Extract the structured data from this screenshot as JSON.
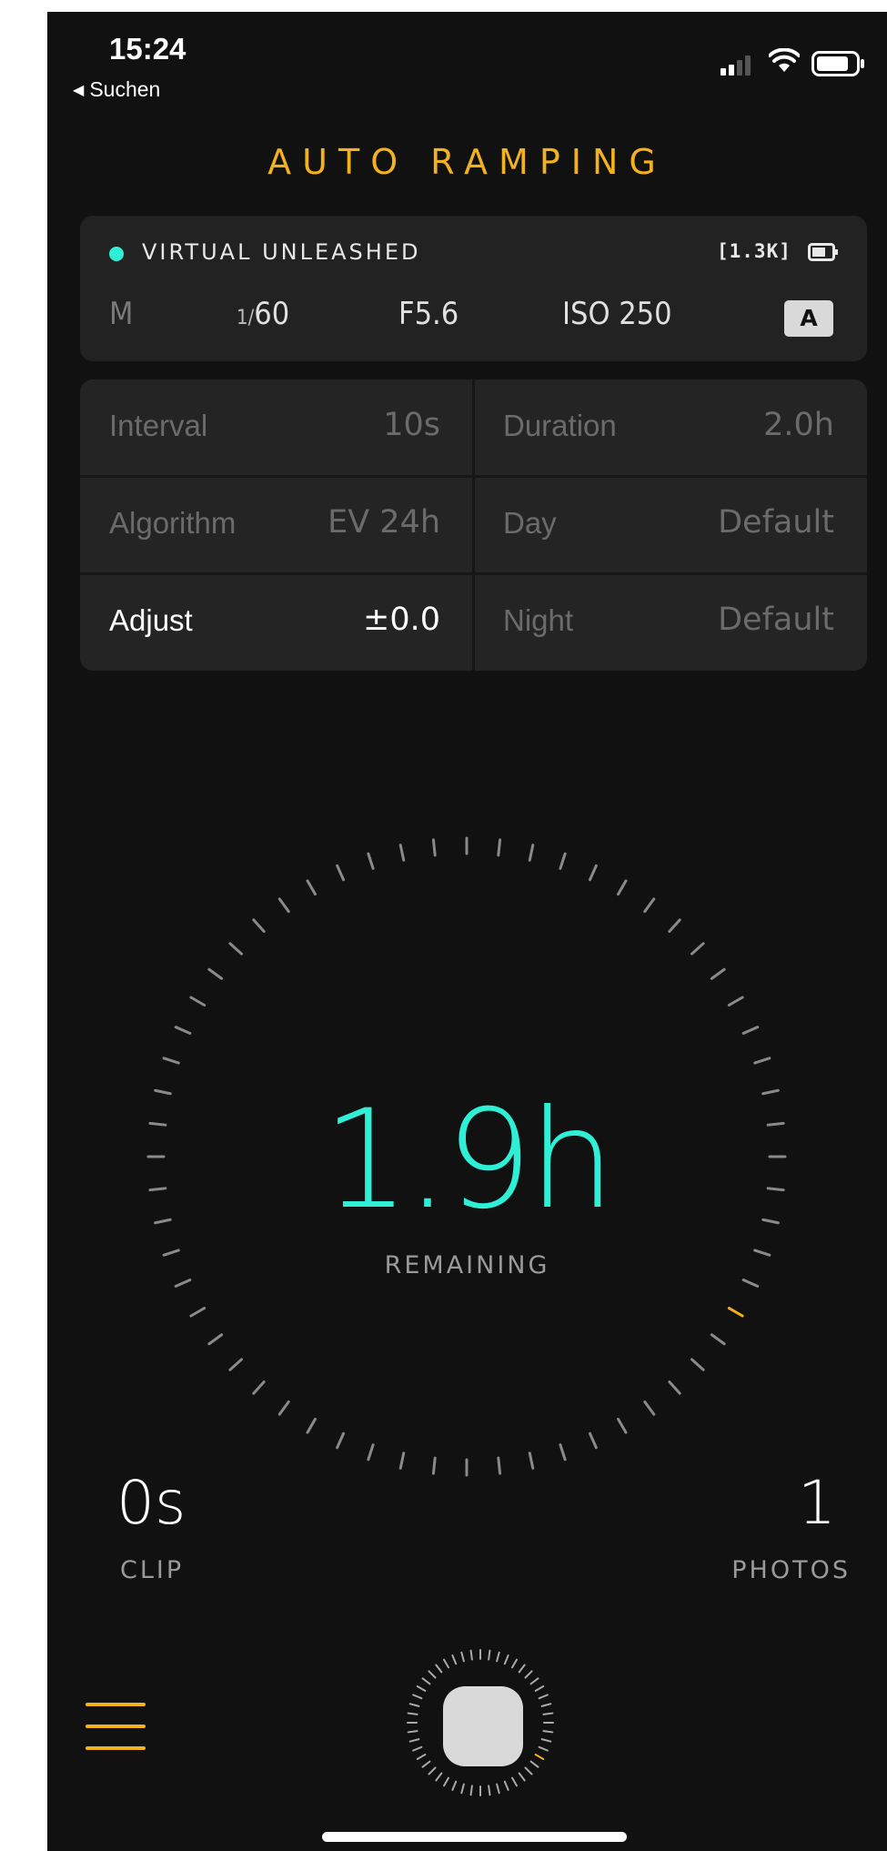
{
  "status_bar": {
    "time": "15:24",
    "back_label": "Suchen"
  },
  "header": {
    "title": "AUTO RAMPING"
  },
  "camera": {
    "name": "VIRTUAL UNLEASHED",
    "resolution": "[1.3K]",
    "mode": "M",
    "shutter_prefix": "1/",
    "shutter_value": "60",
    "aperture": "F5.6",
    "iso": "ISO 250",
    "auto_badge": "A",
    "status_color": "#2ff0d6"
  },
  "settings": {
    "interval": {
      "label": "Interval",
      "value": "10s"
    },
    "duration": {
      "label": "Duration",
      "value": "2.0h"
    },
    "algorithm": {
      "label": "Algorithm",
      "value": "EV 24h"
    },
    "day": {
      "label": "Day",
      "value": "Default"
    },
    "adjust": {
      "label": "Adjust",
      "value": "±0.0"
    },
    "night": {
      "label": "Night",
      "value": "Default"
    }
  },
  "timer": {
    "value": "1.9h",
    "label": "REMAINING",
    "accent_color": "#2ff0d6",
    "progress_color": "#f2b11e"
  },
  "stats": {
    "clip_value": "0s",
    "clip_label": "CLIP",
    "photos_value": "1",
    "photos_label": "PHOTOS"
  },
  "icons": {
    "menu": "hamburger-menu-icon",
    "signal": "cellular-signal-icon",
    "wifi": "wifi-icon",
    "battery": "battery-icon",
    "camera_battery": "camera-battery-icon"
  }
}
